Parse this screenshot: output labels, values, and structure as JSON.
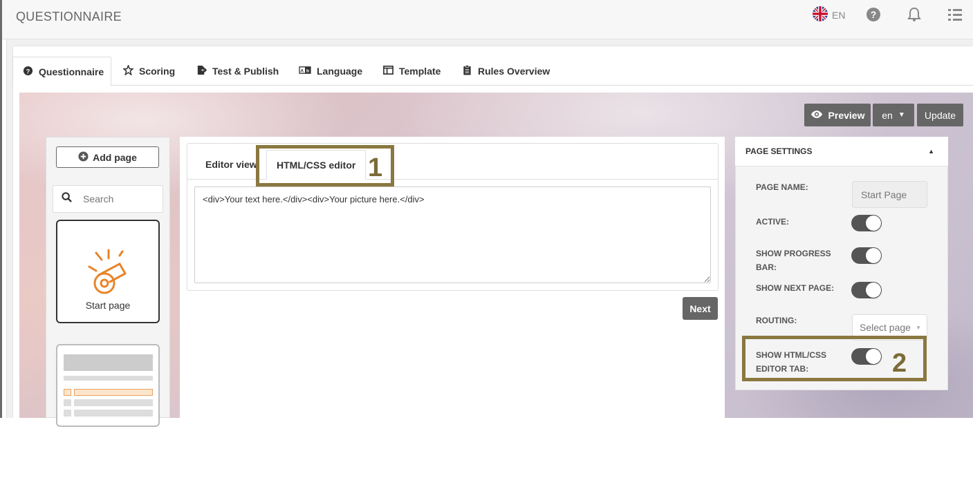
{
  "app": {
    "title": "QUESTIONNAIRE",
    "language_code": "EN"
  },
  "main_tabs": [
    {
      "label": "Questionnaire",
      "icon": "question-circle-icon"
    },
    {
      "label": "Scoring",
      "icon": "star-icon"
    },
    {
      "label": "Test & Publish",
      "icon": "publish-icon"
    },
    {
      "label": "Language",
      "icon": "language-icon"
    },
    {
      "label": "Template",
      "icon": "template-icon"
    },
    {
      "label": "Rules Overview",
      "icon": "clipboard-icon"
    }
  ],
  "toolbar": {
    "preview_label": "Preview",
    "lang_select": "en",
    "update_label": "Update"
  },
  "sidebar": {
    "add_page_label": "Add page",
    "search_placeholder": "Search",
    "pages": [
      {
        "label": "Start page",
        "icon": "whistle-icon"
      }
    ]
  },
  "editor": {
    "tabs": [
      {
        "label": "Editor view"
      },
      {
        "label": "HTML/CSS editor"
      }
    ],
    "code": "<div>Your text here.</div><div>Your picture here.</div>",
    "next_label": "Next"
  },
  "settings": {
    "title": "PAGE SETTINGS",
    "page_name_label": "PAGE NAME:",
    "page_name_value": "Start Page",
    "active_label": "ACTIVE:",
    "active": true,
    "progress_label_1": "SHOW PROGRESS",
    "progress_label_2": "BAR:",
    "show_progress": true,
    "next_page_label": "SHOW NEXT PAGE:",
    "show_next": true,
    "routing_label": "ROUTING:",
    "routing_placeholder": "Select page",
    "html_tab_label_1": "SHOW HTML/CSS",
    "html_tab_label_2": "EDITOR TAB:",
    "show_html": true
  },
  "annotations": {
    "one": "1",
    "two": "2"
  },
  "colors": {
    "highlight": "#8a7840",
    "accent_orange": "#e8842a",
    "dark_button": "#666666"
  }
}
